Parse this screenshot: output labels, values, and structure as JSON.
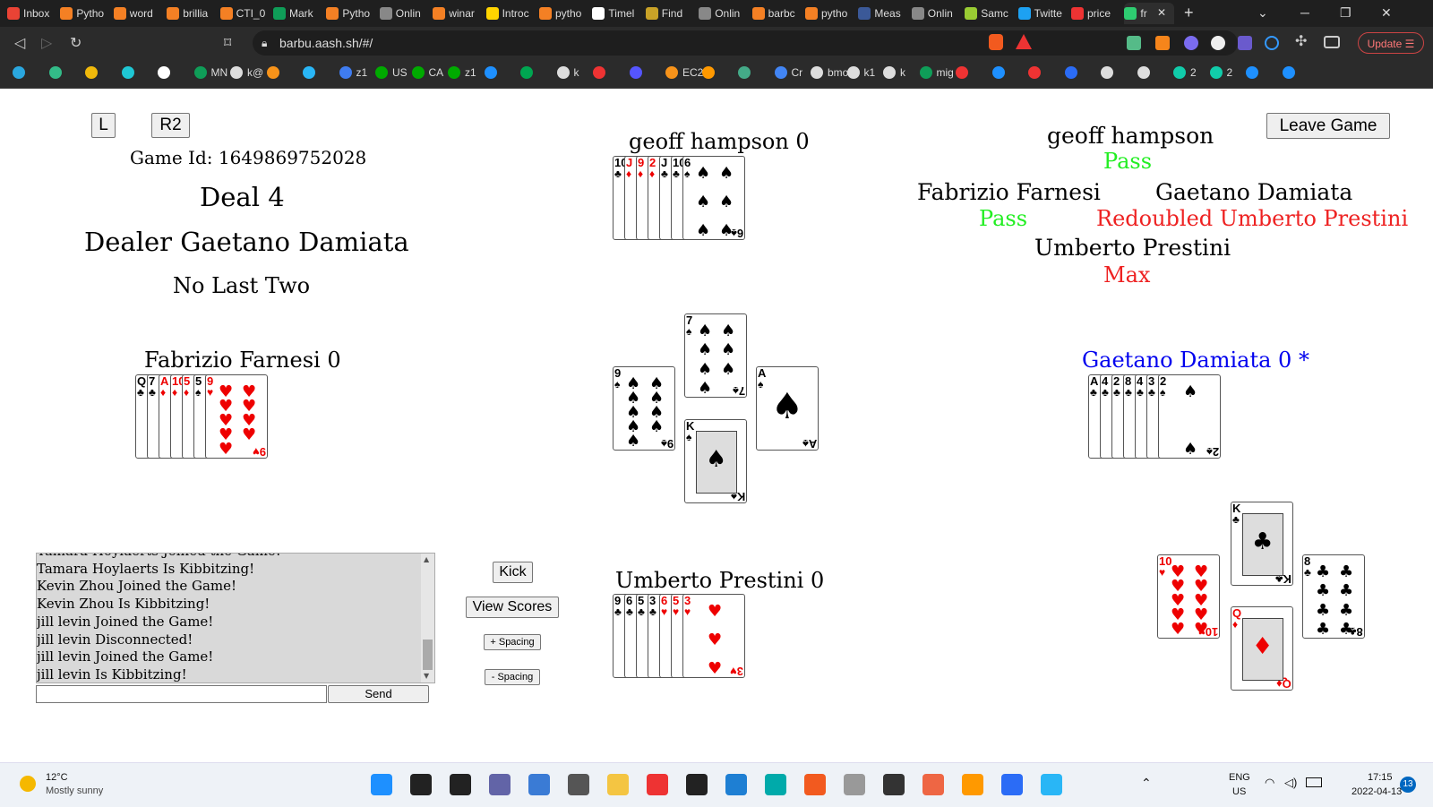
{
  "browser": {
    "tabs": [
      {
        "label": "Inbox",
        "color": "#ea4335"
      },
      {
        "label": "Pytho",
        "color": "#f48024"
      },
      {
        "label": "word",
        "color": "#f48024"
      },
      {
        "label": "brillia",
        "color": "#f48024"
      },
      {
        "label": "CTI_0",
        "color": "#f48024"
      },
      {
        "label": "Mark",
        "color": "#0f9d58"
      },
      {
        "label": "Pytho",
        "color": "#f48024"
      },
      {
        "label": "Onlin",
        "color": "#888"
      },
      {
        "label": "winar",
        "color": "#f48024"
      },
      {
        "label": "Introc",
        "color": "#ffd400"
      },
      {
        "label": "pytho",
        "color": "#f48024"
      },
      {
        "label": "Timel",
        "color": "#fff"
      },
      {
        "label": "Find",
        "color": "#c9a227"
      },
      {
        "label": "Onlin",
        "color": "#888"
      },
      {
        "label": "barbc",
        "color": "#f48024"
      },
      {
        "label": "pytho",
        "color": "#f48024"
      },
      {
        "label": "Meas",
        "color": "#3b5998"
      },
      {
        "label": "Onlin",
        "color": "#888"
      },
      {
        "label": "Samc",
        "color": "#9c3"
      },
      {
        "label": "Twitte",
        "color": "#1da1f2"
      },
      {
        "label": "price",
        "color": "#e33"
      },
      {
        "label": "fr",
        "color": "#2ecc71"
      }
    ],
    "url": "barbu.aash.sh/#/",
    "update_label": "Update",
    "bookmarks": [
      "",
      "",
      "",
      "",
      "",
      "MN",
      "k@",
      "",
      "",
      "z1",
      "US",
      "CA",
      "z1",
      "",
      "",
      "k",
      "",
      "",
      "EC2",
      "",
      "",
      "Cr",
      "bmo",
      "k1",
      "k",
      "mig",
      "",
      "",
      "",
      "",
      "",
      "",
      "2",
      "2",
      "",
      ""
    ]
  },
  "game": {
    "btn_l": "L",
    "btn_r2": "R2",
    "game_id": "Game Id: 1649869752028",
    "deal": "Deal 4",
    "dealer": "Dealer Gaetano Damiata",
    "contract": "No Last Two",
    "leave": "Leave Game",
    "players": {
      "north": "geoff hampson 0",
      "west": "Fabrizio Farnesi 0",
      "south": "Umberto Prestini 0",
      "east": "Gaetano Damiata 0 *"
    },
    "bids": {
      "north_name": "geoff hampson",
      "north_bid": "Pass",
      "west_name": "Fabrizio Farnesi",
      "west_bid": "Pass",
      "east_name": "Gaetano Damiata",
      "east_bid": "Redoubled Umberto Prestini",
      "south_name": "Umberto Prestini",
      "south_bid": "Max"
    },
    "hands": {
      "north": {
        "fan": [
          [
            "10",
            "♣",
            "blk"
          ],
          [
            "J",
            "♦",
            "red"
          ],
          [
            "9",
            "♦",
            "red"
          ],
          [
            "2",
            "♦",
            "red"
          ],
          [
            "J",
            "♣",
            "blk"
          ],
          [
            "10",
            "♣",
            "blk"
          ]
        ],
        "last": [
          "6",
          "♠",
          "blk"
        ]
      },
      "west": {
        "fan": [
          [
            "Q",
            "♣",
            "blk"
          ],
          [
            "7",
            "♣",
            "blk"
          ],
          [
            "A",
            "♦",
            "red"
          ],
          [
            "10",
            "♦",
            "red"
          ],
          [
            "5",
            "♦",
            "red"
          ],
          [
            "5",
            "♠",
            "blk"
          ]
        ],
        "last": [
          "9",
          "♥",
          "red"
        ]
      },
      "east": {
        "fan": [
          [
            "A",
            "♣",
            "blk"
          ],
          [
            "4",
            "♣",
            "blk"
          ],
          [
            "2",
            "♣",
            "blk"
          ],
          [
            "8",
            "♣",
            "blk"
          ],
          [
            "4",
            "♣",
            "blk"
          ],
          [
            "3",
            "♣",
            "blk"
          ]
        ],
        "last": [
          "2",
          "♠",
          "blk"
        ]
      },
      "south": {
        "fan": [
          [
            "9",
            "♣",
            "blk"
          ],
          [
            "6",
            "♣",
            "blk"
          ],
          [
            "5",
            "♣",
            "blk"
          ],
          [
            "3",
            "♣",
            "blk"
          ],
          [
            "6",
            "♥",
            "red"
          ],
          [
            "5",
            "♥",
            "red"
          ]
        ],
        "last": [
          "3",
          "♥",
          "red"
        ]
      }
    },
    "trick": [
      [
        "7",
        "♠",
        "blk"
      ],
      [
        "9",
        "♠",
        "blk"
      ],
      [
        "A",
        "♠",
        "blk"
      ],
      [
        "K",
        "♠",
        "blk"
      ]
    ],
    "last_trick": [
      [
        "K",
        "♣",
        "blk"
      ],
      [
        "10",
        "♥",
        "red"
      ],
      [
        "8",
        "♣",
        "blk"
      ],
      [
        "Q",
        "♦",
        "red"
      ]
    ]
  },
  "chat": {
    "messages": [
      "Tamara Hoylaerts Joined the Game!",
      "Tamara Hoylaerts Is Kibbitzing!",
      "Kevin Zhou Joined the Game!",
      "Kevin Zhou Is Kibbitzing!",
      "jill levin Joined the Game!",
      "jill levin Disconnected!",
      "jill levin Joined the Game!",
      "jill levin Is Kibbitzing!"
    ],
    "send": "Send"
  },
  "controls": {
    "kick": "Kick",
    "view_scores": "View Scores",
    "plus_spacing": "+ Spacing",
    "minus_spacing": "- Spacing"
  },
  "taskbar": {
    "temp": "12°C",
    "weather": "Mostly sunny",
    "lang1": "ENG",
    "lang2": "US",
    "time": "17:15",
    "date": "2022-04-13",
    "notif": "13"
  }
}
